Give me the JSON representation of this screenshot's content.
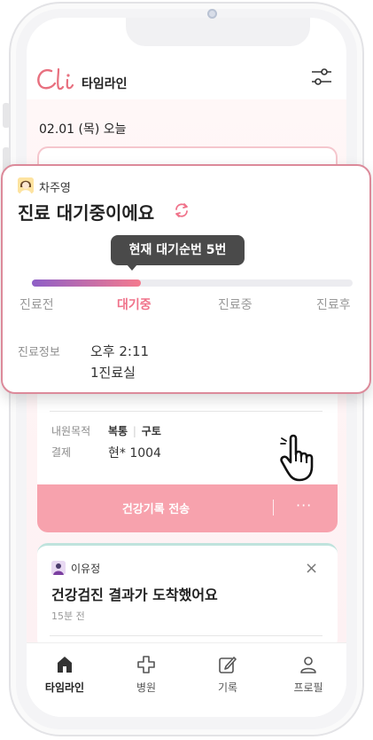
{
  "header": {
    "title": "타임라인",
    "logo_icon": "cli-logo-icon",
    "filter_icon": "filter-sliders-icon"
  },
  "timeline": {
    "date_label": "02.01 (목) 오늘"
  },
  "status_card": {
    "patient_name": "차주영",
    "title": "진료 대기중이에요",
    "tooltip": "현재 대기순번 5번",
    "progress": 0.34,
    "steps": [
      "진료전",
      "대기중",
      "진료중",
      "진료후"
    ],
    "active_step": "대기중",
    "detail_label": "진료정보",
    "detail_time": "오후 2:11",
    "detail_room": "1진료실"
  },
  "visit_info": {
    "purpose_label": "내원목적",
    "purpose_value_1": "복통",
    "purpose_value_2": "구토",
    "payment_label": "결제",
    "payment_value": "현* 1004",
    "send_button": "건강기록 전송",
    "more_label": "···"
  },
  "notification_card": {
    "name": "이유정",
    "title": "건강검진 결과가 도착했어요",
    "time": "15분 전",
    "close_label": "×"
  },
  "bottom_nav": {
    "items": [
      {
        "label": "타임라인",
        "icon": "home-icon"
      },
      {
        "label": "병원",
        "icon": "hospital-cross-icon"
      },
      {
        "label": "기록",
        "icon": "edit-icon"
      },
      {
        "label": "프로필",
        "icon": "user-icon"
      }
    ],
    "active": "타임라인"
  },
  "colors": {
    "accent": "#f0728a",
    "progress_start": "#8e5fc7",
    "progress_end": "#f47a8e",
    "send_button": "#f7a2ad"
  }
}
